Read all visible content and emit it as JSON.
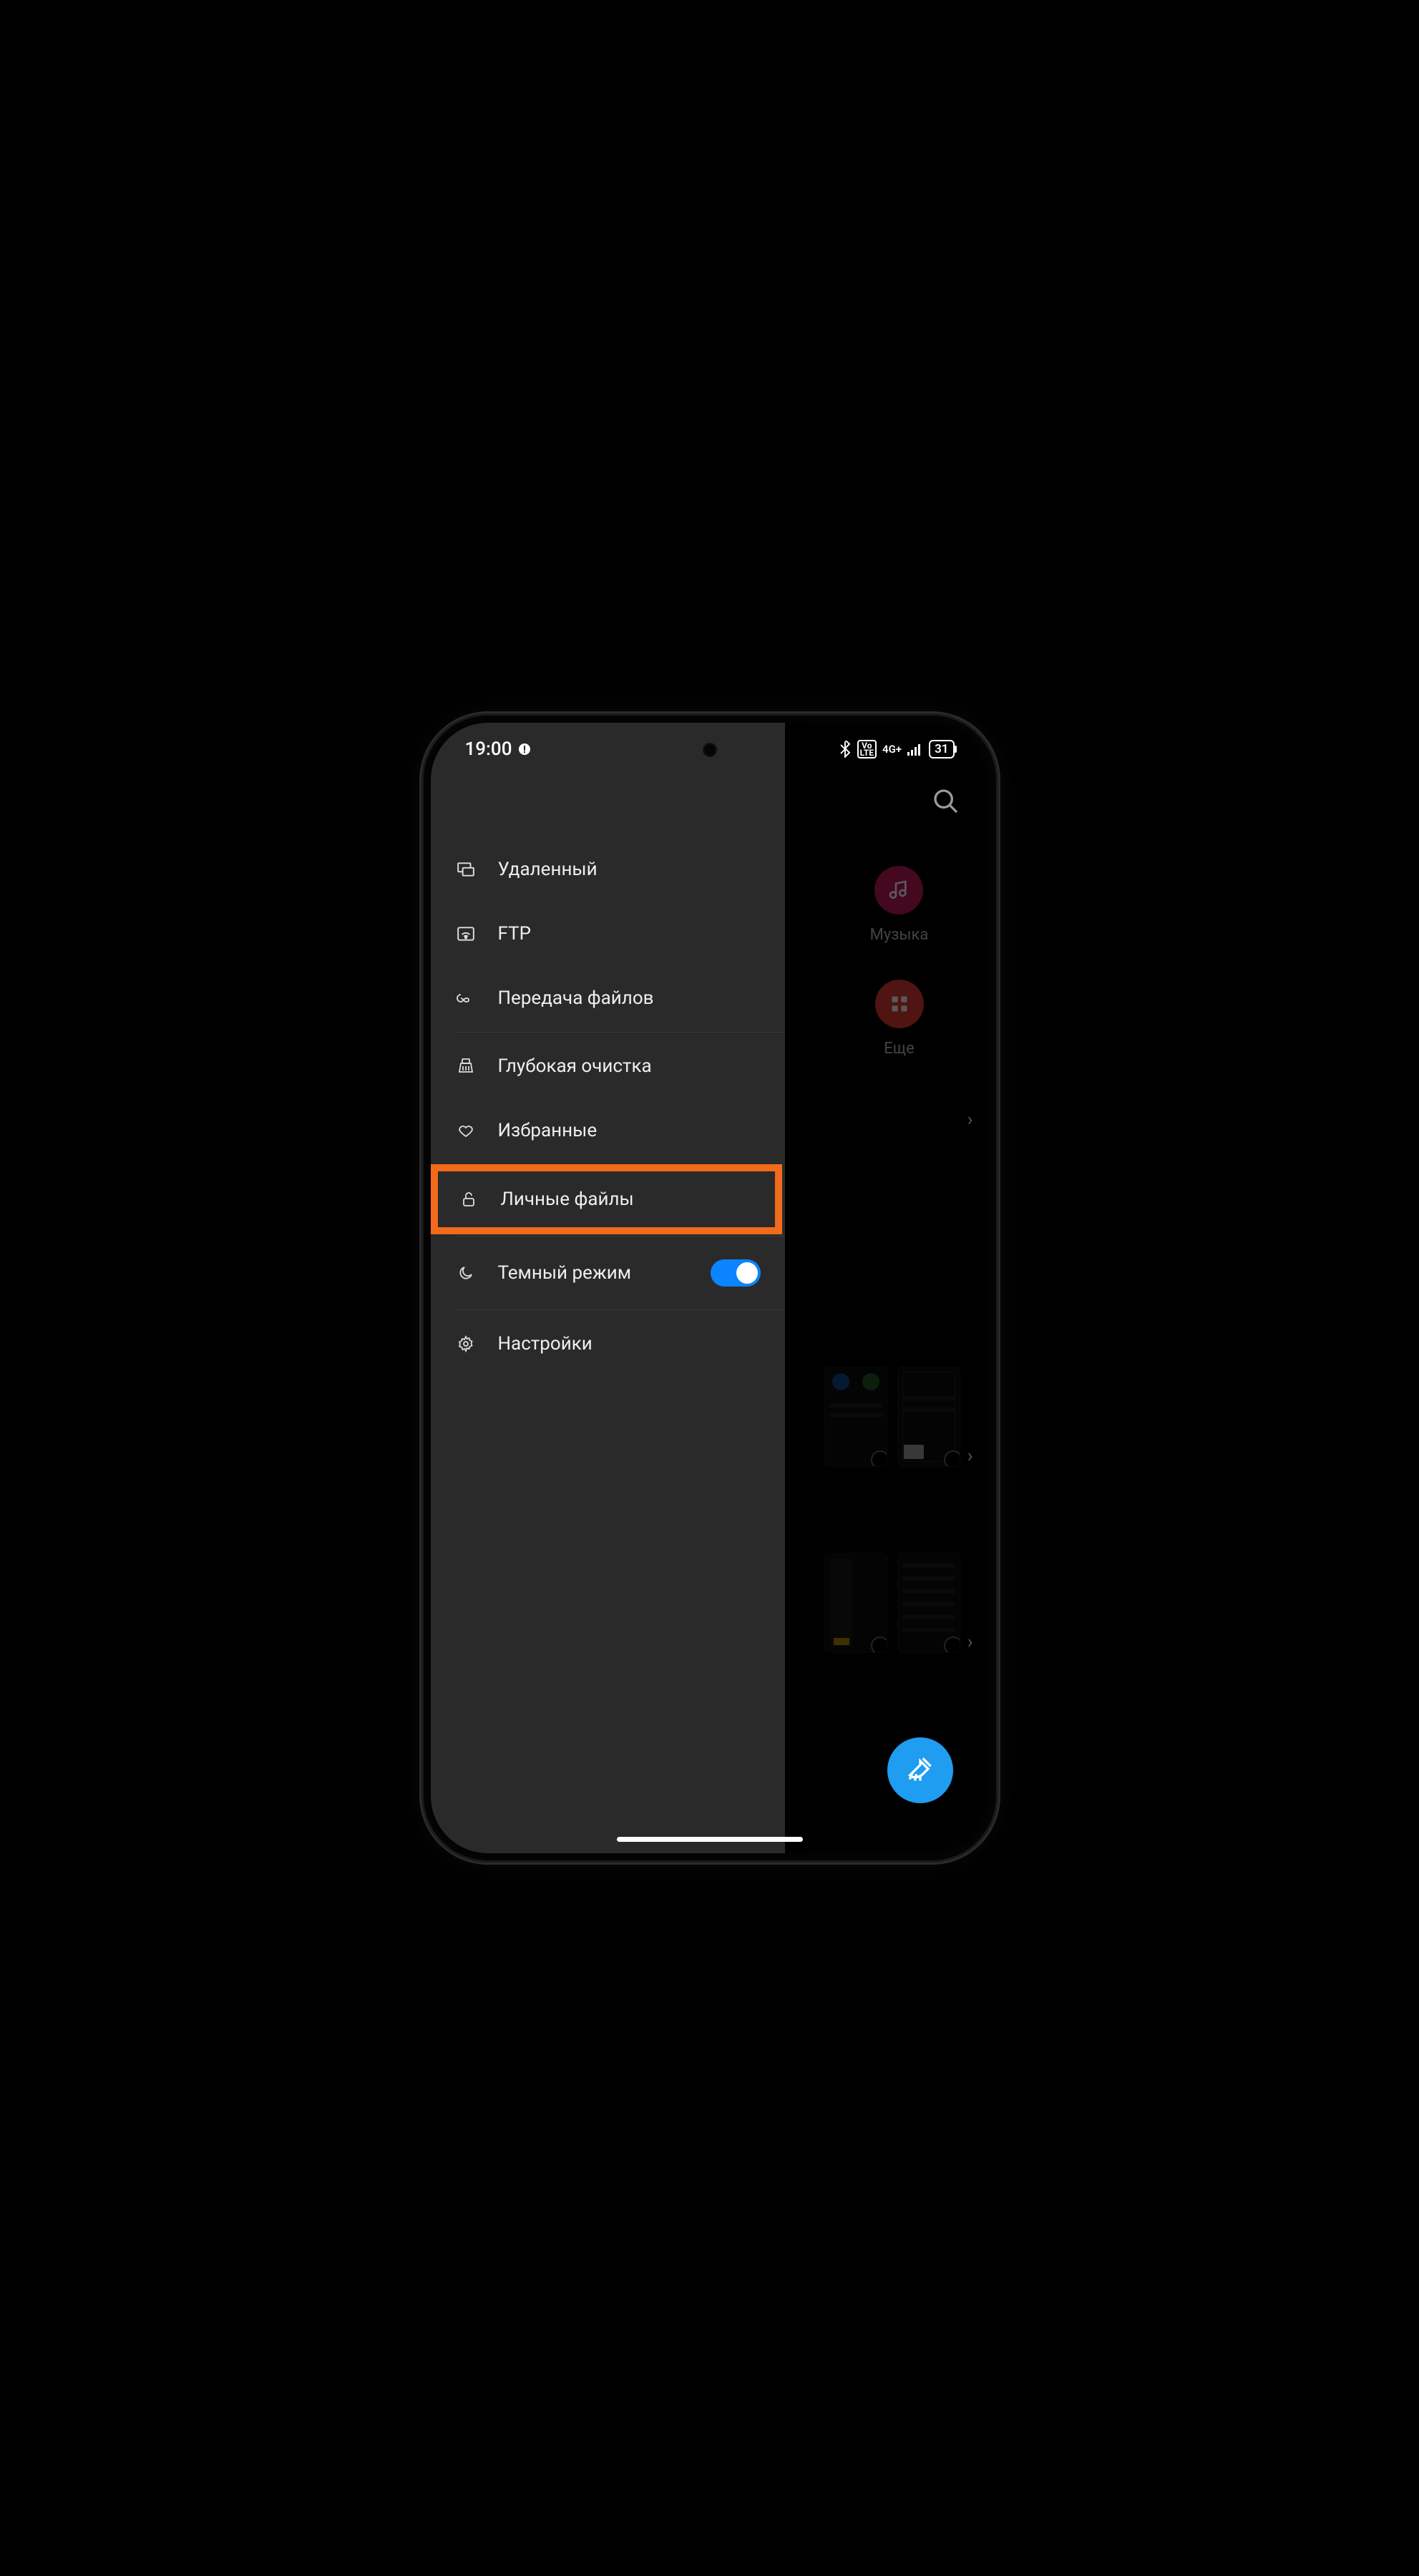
{
  "status": {
    "time": "19:00",
    "battery": "31",
    "network": "4G+"
  },
  "drawer": {
    "items": [
      {
        "id": "remote",
        "label": "Удаленный",
        "icon": "monitor-icon"
      },
      {
        "id": "ftp",
        "label": "FTP",
        "icon": "wifi-box-icon"
      },
      {
        "id": "transfer",
        "label": "Передача файлов",
        "icon": "infinity-icon"
      },
      {
        "id": "deepclean",
        "label": "Глубокая очистка",
        "icon": "broom-box-icon"
      },
      {
        "id": "favorites",
        "label": "Избранные",
        "icon": "heart-icon"
      },
      {
        "id": "private",
        "label": "Личные файлы",
        "icon": "lock-open-icon",
        "highlighted": true
      },
      {
        "id": "darkmode",
        "label": "Темный режим",
        "icon": "moon-icon",
        "toggle": true,
        "toggle_on": true
      },
      {
        "id": "settings",
        "label": "Настройки",
        "icon": "gear-icon"
      }
    ]
  },
  "background": {
    "categories": [
      {
        "id": "music",
        "label": "Музыка"
      },
      {
        "id": "more",
        "label": "Еще"
      }
    ]
  }
}
